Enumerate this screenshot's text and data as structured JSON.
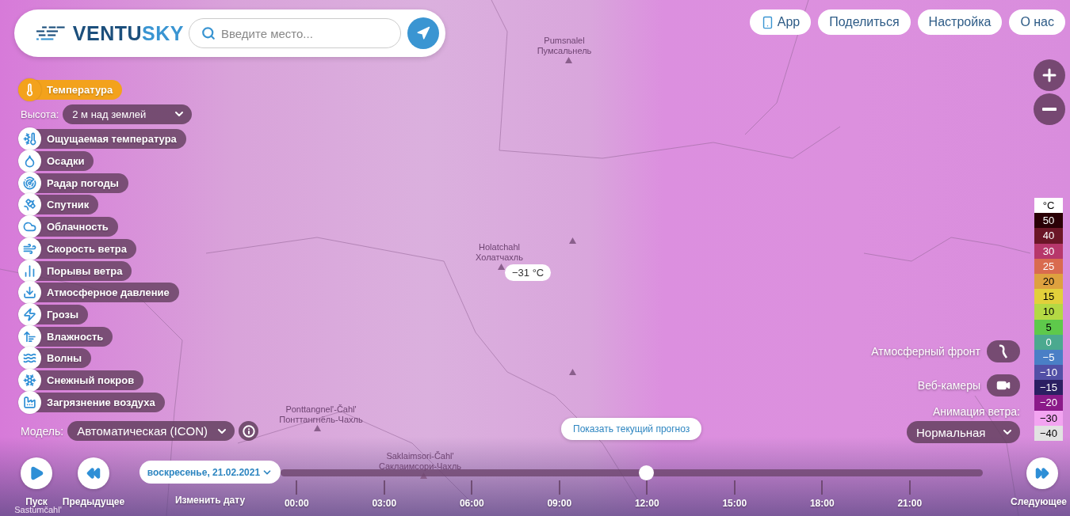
{
  "logo_parts": [
    "VENTU",
    "SKY"
  ],
  "search": {
    "placeholder": "Введите место..."
  },
  "top_menu": [
    {
      "label": "App",
      "kind": "app"
    },
    {
      "label": "Поделиться",
      "kind": "plain"
    },
    {
      "label": "Настройка",
      "kind": "plain"
    },
    {
      "label": "О нас",
      "kind": "plain"
    }
  ],
  "active_layer": {
    "label": "Температура",
    "selected": true
  },
  "height": {
    "label": "Высота:",
    "value": "2 м над землей"
  },
  "layers": [
    {
      "label": "Ощущаемая температура",
      "selected": false
    },
    {
      "label": "Осадки",
      "selected": false
    },
    {
      "label": "Радар погоды",
      "selected": false
    },
    {
      "label": "Спутник",
      "selected": false
    },
    {
      "label": "Облачность",
      "selected": false
    },
    {
      "label": "Скорость ветра",
      "selected": false
    },
    {
      "label": "Порывы ветра",
      "selected": false
    },
    {
      "label": "Атмосферное давление",
      "selected": false
    },
    {
      "label": "Грозы",
      "selected": false
    },
    {
      "label": "Влажность",
      "selected": false
    },
    {
      "label": "Волны",
      "selected": false
    },
    {
      "label": "Снежный покров",
      "selected": false
    },
    {
      "label": "Загрязнение воздуха",
      "selected": false
    }
  ],
  "model": {
    "label": "Модель:",
    "value": "Автоматическая (ICON)"
  },
  "map_labels": [
    {
      "latin": "Pumsnalel",
      "cyrillic": "Пумсальнель"
    },
    {
      "latin": "Holatchahl",
      "cyrillic": "Холатчахль"
    },
    {
      "latin": "Ponttangnel'-Čahl'",
      "cyrillic": "Понттангнёль-Чахль"
    },
    {
      "latin": "Saklaimsori-Čahl'",
      "cyrillic": "Саклаимсори-Чахль"
    },
    {
      "latin": "Sastumčahl'"
    }
  ],
  "temperature_popup": "−31 °C",
  "current_forecast_button": "Показать текущий прогноз",
  "right_controls": {
    "front": "Атмосферный фронт",
    "front_on": false,
    "webcams": "Веб-камеры",
    "webcams_on": false,
    "wind_animation_label": "Анимация ветра:",
    "wind_animation_value": "Нормальная"
  },
  "legend": {
    "unit": "°C",
    "items": [
      {
        "value": "50",
        "color": "#2a0006"
      },
      {
        "value": "40",
        "color": "#6b1627"
      },
      {
        "value": "30",
        "color": "#b7376b"
      },
      {
        "value": "25",
        "color": "#d96b4f"
      },
      {
        "value": "20",
        "color": "#dea13f"
      },
      {
        "value": "15",
        "color": "#e2d03b"
      },
      {
        "value": "10",
        "color": "#b4d944"
      },
      {
        "value": "5",
        "color": "#5ec94b"
      },
      {
        "value": "0",
        "color": "#4ba98f"
      },
      {
        "value": "−5",
        "color": "#4a7fc6"
      },
      {
        "value": "−10",
        "color": "#5250a6"
      },
      {
        "value": "−15",
        "color": "#2b1f62"
      },
      {
        "value": "−20",
        "color": "#8b1a89"
      },
      {
        "value": "−30",
        "color": "#f3a4f1"
      },
      {
        "value": "−40",
        "color": "#e2e2e2"
      }
    ]
  },
  "timeline": {
    "play": "Пуск",
    "previous": "Предыдущее",
    "date": "воскресенье, 21.02.2021",
    "change_date": "Изменить дату",
    "hours": [
      "00:00",
      "03:00",
      "06:00",
      "09:00",
      "12:00",
      "15:00",
      "18:00",
      "21:00"
    ],
    "level": 0.52,
    "next": "Следующее"
  }
}
